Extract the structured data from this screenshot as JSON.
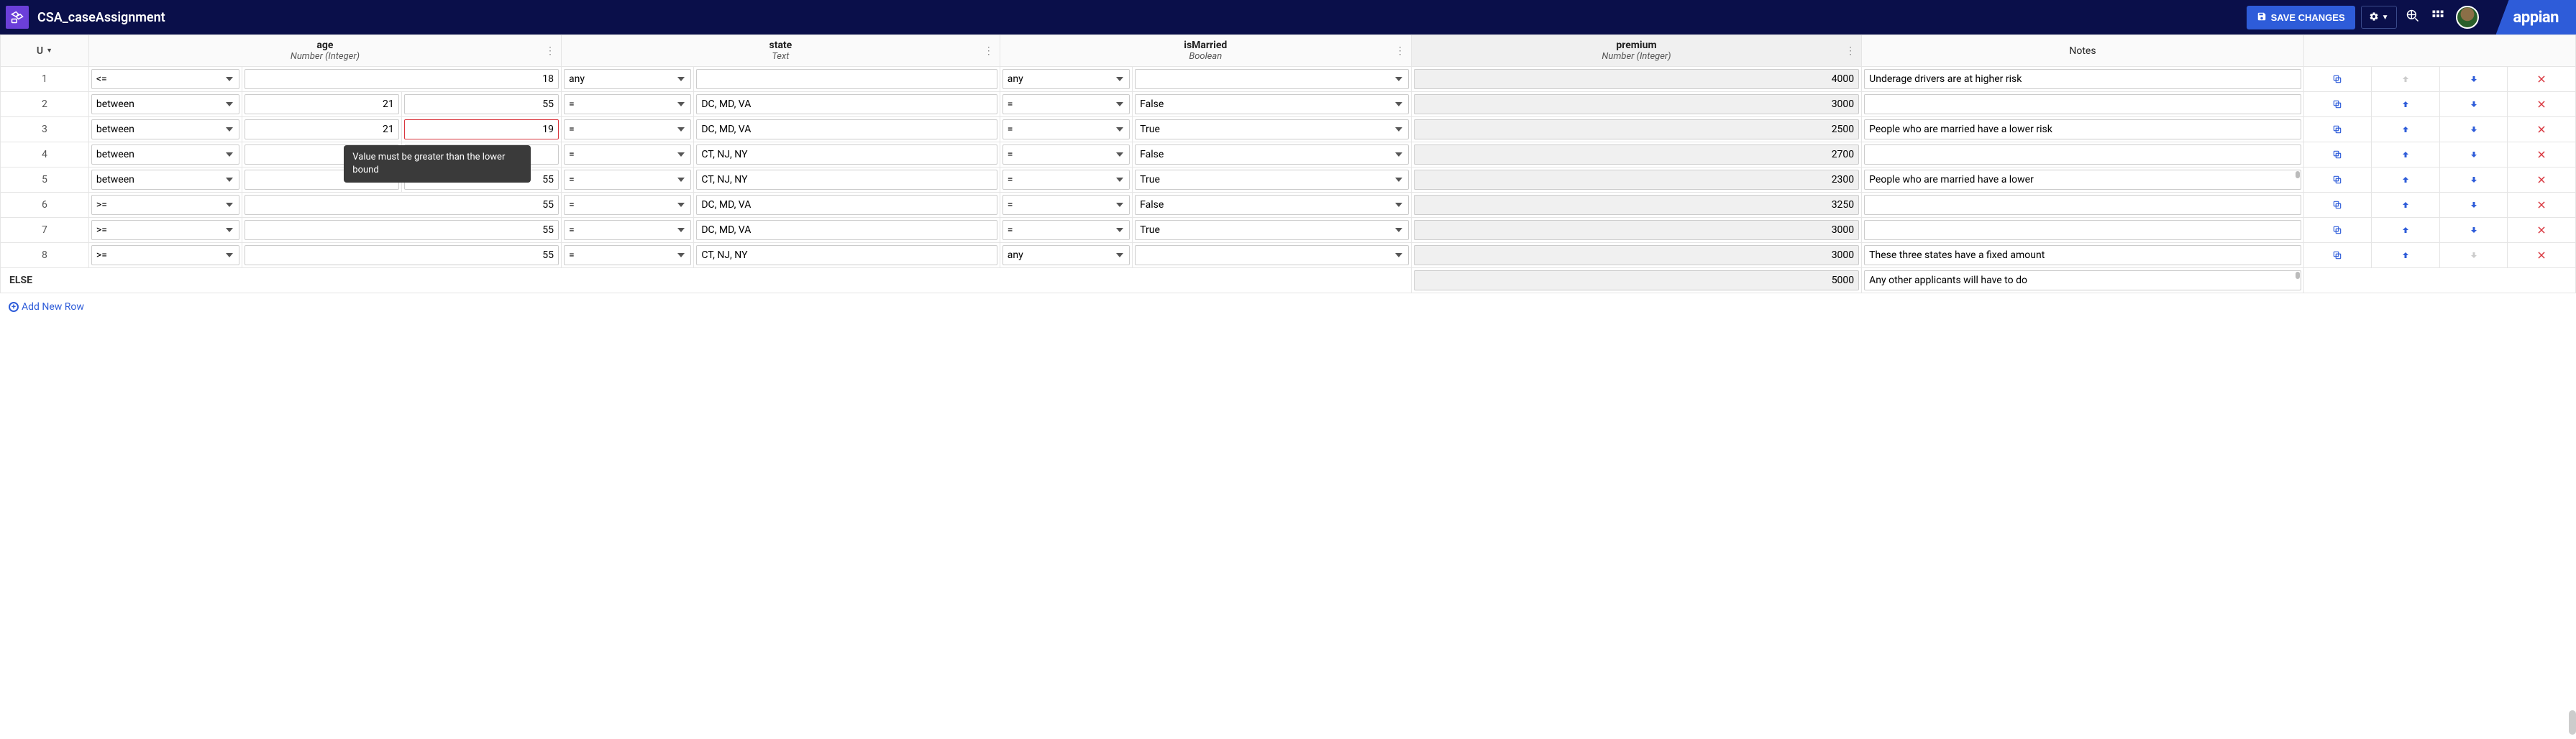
{
  "header": {
    "title": "CSA_caseAssignment",
    "save_label": "SAVE CHANGES",
    "brand": "appian"
  },
  "columns": {
    "u_label": "U",
    "age": {
      "name": "age",
      "type": "Number (Integer)"
    },
    "state": {
      "name": "state",
      "type": "Text"
    },
    "isMarried": {
      "name": "isMarried",
      "type": "Boolean"
    },
    "premium": {
      "name": "premium",
      "type": "Number (Integer)"
    },
    "notes": {
      "name": "Notes"
    }
  },
  "operators": {
    "lte": "<=",
    "between": "between",
    "gte": ">=",
    "eq": "=",
    "any": "any"
  },
  "bool": {
    "true": "True",
    "false": "False"
  },
  "rows": [
    {
      "num": "1",
      "age_op": "lte",
      "age_lo": "",
      "age_hi": "18",
      "state_op": "any",
      "state": "",
      "married_op": "any",
      "married": "",
      "premium": "4000",
      "notes": "Underage drivers are at higher risk"
    },
    {
      "num": "2",
      "age_op": "between",
      "age_lo": "21",
      "age_hi": "55",
      "state_op": "eq",
      "state": "DC, MD, VA",
      "married_op": "eq",
      "married": "false",
      "premium": "3000",
      "notes": ""
    },
    {
      "num": "3",
      "age_op": "between",
      "age_lo": "21",
      "age_hi": "19",
      "state_op": "eq",
      "state": "DC, MD, VA",
      "married_op": "eq",
      "married": "true",
      "premium": "2500",
      "notes": "People who are married have a lower risk",
      "invalid_hi": true
    },
    {
      "num": "4",
      "age_op": "between",
      "age_lo": "",
      "age_hi": "",
      "state_op": "eq",
      "state": "CT, NJ, NY",
      "married_op": "eq",
      "married": "false",
      "premium": "2700",
      "notes": ""
    },
    {
      "num": "5",
      "age_op": "between",
      "age_lo": "21",
      "age_hi": "55",
      "state_op": "eq",
      "state": "CT, NJ, NY",
      "married_op": "eq",
      "married": "true",
      "premium": "2300",
      "notes": "People who are married have a lower",
      "notes_overflow": true
    },
    {
      "num": "6",
      "age_op": "gte",
      "age_lo": "",
      "age_hi": "55",
      "state_op": "eq",
      "state": "DC, MD, VA",
      "married_op": "eq",
      "married": "false",
      "premium": "3250",
      "notes": ""
    },
    {
      "num": "7",
      "age_op": "gte",
      "age_lo": "",
      "age_hi": "55",
      "state_op": "eq",
      "state": "DC, MD, VA",
      "married_op": "eq",
      "married": "true",
      "premium": "3000",
      "notes": ""
    },
    {
      "num": "8",
      "age_op": "gte",
      "age_lo": "",
      "age_hi": "55",
      "state_op": "eq",
      "state": "CT, NJ, NY",
      "married_op": "any",
      "married": "",
      "premium": "3000",
      "notes": "These three states have a fixed amount"
    }
  ],
  "else_row": {
    "label": "ELSE",
    "premium": "5000",
    "notes": "Any other applicants will have to do",
    "notes_overflow": true
  },
  "validation": {
    "lower_bound_msg": "Value must be greater than the lower bound"
  },
  "footer": {
    "add_row": "Add New Row"
  }
}
